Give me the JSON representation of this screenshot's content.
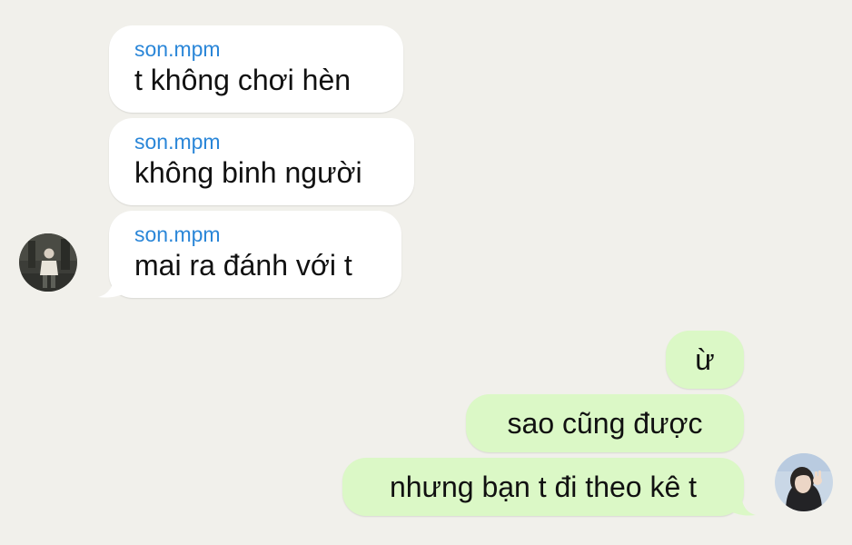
{
  "colors": {
    "background": "#f1f0eb",
    "incoming_bubble": "#ffffff",
    "outgoing_bubble": "#dbf8c6",
    "sender_name": "#2a86d8",
    "message_text": "#111111"
  },
  "incoming_messages": [
    {
      "sender": "son.mpm",
      "text": "t không chơi hèn"
    },
    {
      "sender": "son.mpm",
      "text": "không binh người"
    },
    {
      "sender": "son.mpm",
      "text": "mai ra đánh với t"
    }
  ],
  "outgoing_messages": [
    {
      "text": "ừ"
    },
    {
      "text": "sao cũng được"
    },
    {
      "text": "nhưng bạn t đi theo kê t"
    }
  ],
  "avatars": {
    "contact": "contact-avatar-photo",
    "self": "self-avatar-photo"
  }
}
